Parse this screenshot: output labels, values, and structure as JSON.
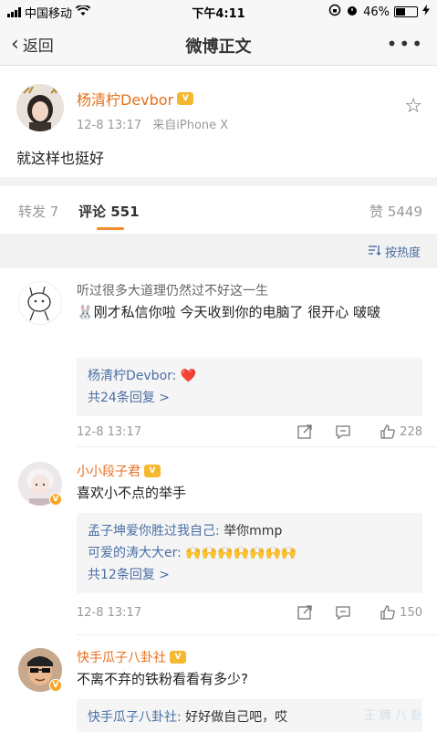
{
  "status_bar": {
    "carrier": "中国移动",
    "time": "下午4:11",
    "battery": "46%",
    "battery_level": 0.46
  },
  "nav": {
    "back_label": "返回",
    "title": "微博正文",
    "more": "•••"
  },
  "post": {
    "author": "杨清柠Devbor",
    "date": "12-8 13:17",
    "source": "来自iPhone X",
    "text": "就这样也挺好"
  },
  "tabs": {
    "repost": "转发 7",
    "comment": "评论 551",
    "like": "赞 5449"
  },
  "sort_label": "按热度",
  "comments": [
    {
      "name": "听过很多大道理仍然过不好这一生",
      "text": "🐰刚才私信你啦 今天收到你的电脑了 很开心 啵啵",
      "replies": [
        {
          "name": "杨清柠Devbor:",
          "text": "❤️"
        }
      ],
      "more": "共24条回复 >",
      "time": "12-8 13:17",
      "likes": "228"
    },
    {
      "name": "小小段子君",
      "text": "喜欢小不点的举手",
      "replies": [
        {
          "name": "孟子坤爱你胜过我自己:",
          "text": "举你mmp"
        },
        {
          "name": "可爱的涛大大er:",
          "text": "🙌🙌🙌🙌🙌🙌🙌"
        }
      ],
      "more": "共12条回复 >",
      "time": "12-8 13:17",
      "likes": "150"
    },
    {
      "name": "快手瓜子八卦社",
      "text": "不离不弃的铁粉看看有多少?",
      "replies": [
        {
          "name": "快手瓜子八卦社:",
          "text": "好好做自己吧，哎"
        }
      ]
    }
  ],
  "watermark": "王牌八卦",
  "colors": {
    "accent": "#e86f1b",
    "link": "#4a6fa5",
    "tab_underline": "#f58b2a"
  }
}
